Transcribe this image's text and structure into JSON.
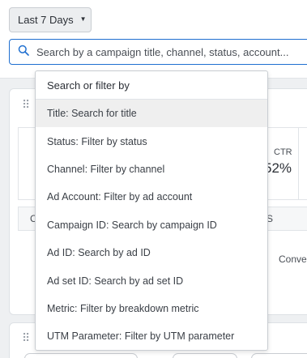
{
  "date_range": {
    "label": "Last 7 Days",
    "caret": "▼"
  },
  "search": {
    "placeholder": "Search by a campaign title, channel, status, account..."
  },
  "dropdown": {
    "header": "Search or filter by",
    "items": [
      {
        "label": "Title: Search for title",
        "highlighted": true
      },
      {
        "label": "Status: Filter by status"
      },
      {
        "label": "Channel: Filter by channel"
      },
      {
        "label": "Ad Account: Filter by ad account"
      },
      {
        "label": "Campaign ID: Search by campaign ID"
      },
      {
        "label": "Ad ID: Search by ad ID"
      },
      {
        "label": "Ad set ID: Search by ad set ID"
      },
      {
        "label": "Metric: Filter by breakdown metric"
      },
      {
        "label": "UTM Parameter: Filter by UTM parameter"
      }
    ]
  },
  "background": {
    "metric_label": "CTR",
    "metric_value": "52%",
    "table_header_left": "C",
    "table_header_right": "S",
    "cell_partial": "Conve"
  },
  "colors": {
    "accent": "#1f6fd0",
    "highlight": "#efefef",
    "page_bg": "#eef0f2"
  }
}
